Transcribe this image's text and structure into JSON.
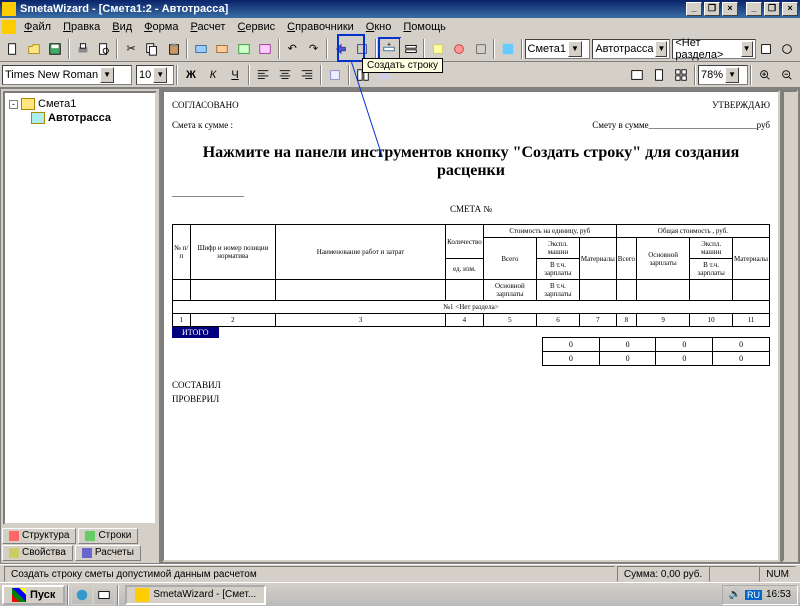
{
  "app": {
    "title": "SmetaWizard - [Смета1:2 - Автотрасса]"
  },
  "menu": [
    "Файл",
    "Правка",
    "Вид",
    "Форма",
    "Расчет",
    "Сервис",
    "Справочники",
    "Окно",
    "Помощь"
  ],
  "toolbar2": {
    "font": "Times New Roman",
    "size": "10",
    "zoom": "78%"
  },
  "combos": {
    "c1": "Смета1",
    "c2": "Автотрасса",
    "c3": "<Нет раздела>"
  },
  "tree": {
    "root": "Смета1",
    "child": "Автотрасса"
  },
  "tabs": {
    "t1": "Структура",
    "t2": "Строки",
    "t3": "Свойства",
    "t4": "Расчеты"
  },
  "doc": {
    "agree": "СОГЛАСОВАНО",
    "approve": "УТВЕРЖДАЮ",
    "sum_left": "Смета к сумме :",
    "sum_right": "Смету в сумме________________________руб",
    "instruction": "Нажмите на панели инструментов кнопку \"Создать строку\" для создания расценки",
    "title": "СМЕТА №",
    "section": "№1 <Нет раздела>",
    "itogo": "ИТОГО",
    "compiled": "СОСТАВИЛ",
    "checked": "ПРОВЕРИЛ",
    "zero": "0"
  },
  "headers": {
    "npp": "№ п/п",
    "shifr": "Шифр и номер позиции норматива",
    "name": "Наименование работ и затрат",
    "qty": "Количество",
    "unit_cost": "Стоимость на единицу, руб",
    "total_cost": "Общая стоимость , руб.",
    "ed": "ед. изм.",
    "vsego": "Всего",
    "expl": "Экспл. машин",
    "mat": "Материалы",
    "osn": "Основной зарплаты",
    "vtch": "В т.ч. зарплаты",
    "n1": "1",
    "n2": "2",
    "n3": "3",
    "n4": "4",
    "n5": "5",
    "n6": "6",
    "n7": "7",
    "n8": "8",
    "n9": "9",
    "n10": "10",
    "n11": "11"
  },
  "tooltip": "Создать строку",
  "status": {
    "hint": "Создать строку сметы допустимой данным расчетом",
    "sum": "Сумма: 0,00 руб.",
    "num": "NUM"
  },
  "taskbar": {
    "start": "Пуск",
    "task": "SmetaWizard - [Смет...",
    "time": "16:53",
    "lang": "RU"
  }
}
